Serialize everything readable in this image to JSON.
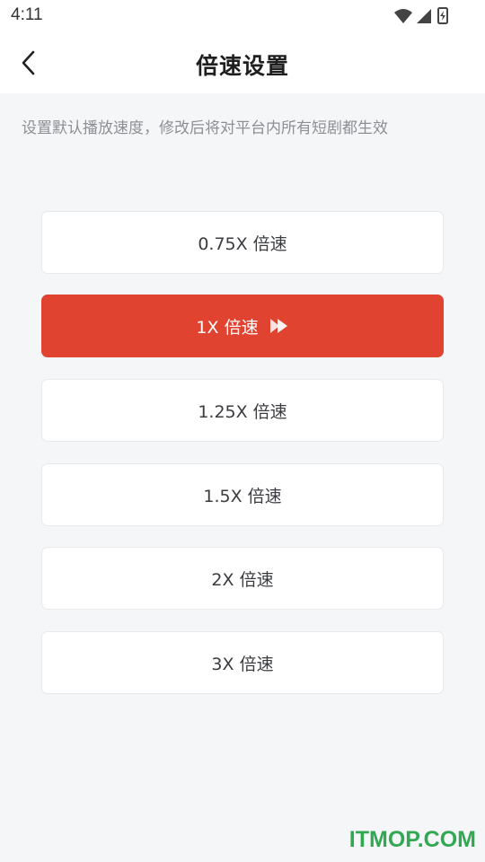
{
  "status_bar": {
    "time": "4:11",
    "icons": [
      "wifi-icon",
      "cellular-signal-icon",
      "battery-charging-icon"
    ]
  },
  "nav": {
    "back_icon": "chevron-left-icon",
    "title": "倍速设置"
  },
  "description": "设置默认播放速度，修改后将对平台内所有短剧都生效",
  "speed_options": [
    {
      "label": "0.75X 倍速",
      "selected": false
    },
    {
      "label": "1X 倍速",
      "selected": true
    },
    {
      "label": "1.25X 倍速",
      "selected": false
    },
    {
      "label": "1.5X 倍速",
      "selected": false
    },
    {
      "label": "2X 倍速",
      "selected": false
    },
    {
      "label": "3X 倍速",
      "selected": false
    }
  ],
  "selected_icon": "fast-forward-icon",
  "colors": {
    "accent": "#e0432f",
    "background": "#f5f6f8",
    "card": "#ffffff",
    "watermark": "#33a853"
  },
  "watermark": "ITMOP.COM"
}
